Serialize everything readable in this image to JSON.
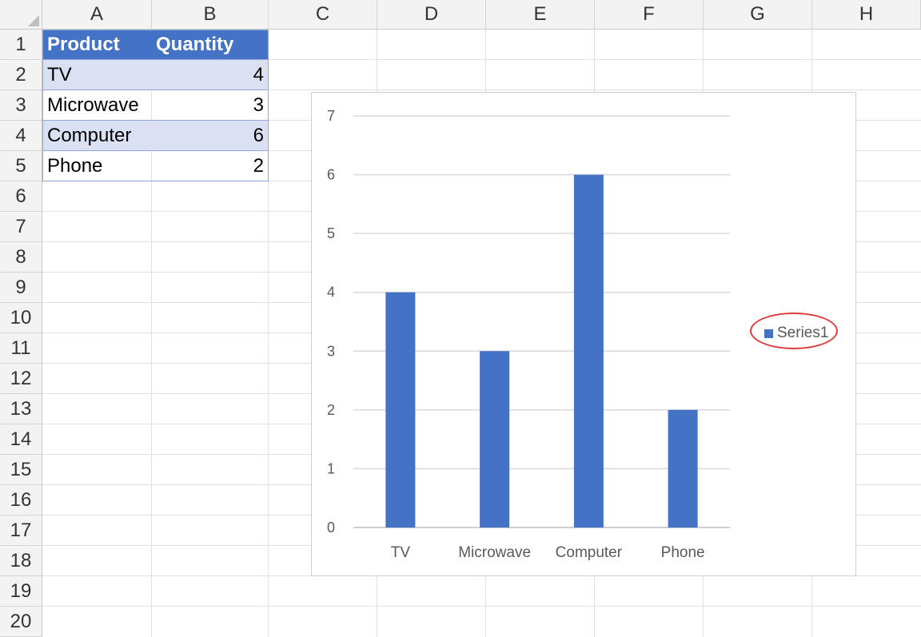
{
  "columns": [
    "A",
    "B",
    "C",
    "D",
    "E",
    "F",
    "G",
    "H"
  ],
  "rows": [
    "1",
    "2",
    "3",
    "4",
    "5",
    "6",
    "7",
    "8",
    "9",
    "10",
    "11",
    "12",
    "13",
    "14",
    "15",
    "16",
    "17",
    "18",
    "19",
    "20"
  ],
  "table": {
    "headers": [
      "Product",
      "Quantity"
    ],
    "rows": [
      {
        "product": "TV",
        "quantity": "4"
      },
      {
        "product": "Microwave",
        "quantity": "3"
      },
      {
        "product": "Computer",
        "quantity": "6"
      },
      {
        "product": "Phone",
        "quantity": "2"
      }
    ]
  },
  "colors": {
    "accent": "#4472c4",
    "band": "#d9e1f2",
    "highlight": "#e03c3c"
  },
  "chart_data": {
    "type": "bar",
    "categories": [
      "TV",
      "Microwave",
      "Computer",
      "Phone"
    ],
    "series": [
      {
        "name": "Series1",
        "values": [
          4,
          3,
          6,
          2
        ]
      }
    ],
    "ylim": [
      0,
      7
    ],
    "yticks": [
      "0",
      "1",
      "2",
      "3",
      "4",
      "5",
      "6",
      "7"
    ],
    "grid": true,
    "legend": "right",
    "legend_highlight": "circled in red"
  }
}
